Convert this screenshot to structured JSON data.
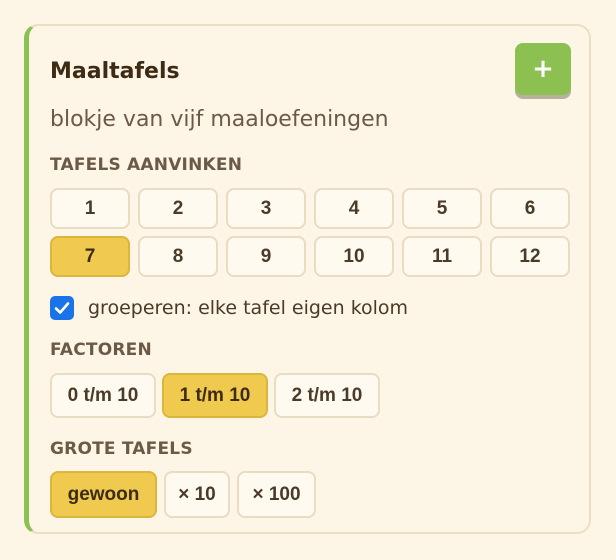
{
  "card": {
    "title": "Maaltafels",
    "add_button_label": "+",
    "subtitle": "blokje van vijf maaloefeningen"
  },
  "tables": {
    "label": "TAFELS AANVINKEN",
    "items": [
      "1",
      "2",
      "3",
      "4",
      "5",
      "6",
      "7",
      "8",
      "9",
      "10",
      "11",
      "12"
    ],
    "selected": [
      "7"
    ]
  },
  "grouping": {
    "checked": true,
    "label": "groeperen: elke tafel eigen kolom"
  },
  "factors": {
    "label": "FACTOREN",
    "options": [
      "0 t/m 10",
      "1 t/m 10",
      "2 t/m 10"
    ],
    "selected": "1 t/m 10"
  },
  "big_tables": {
    "label": "GROTE TAFELS",
    "options": [
      "gewoon",
      "× 10",
      "× 100"
    ],
    "selected": "gewoon"
  },
  "colors": {
    "accent_green": "#8cc152",
    "selected_yellow": "#efca4e",
    "checkbox_blue": "#1a73e8"
  }
}
